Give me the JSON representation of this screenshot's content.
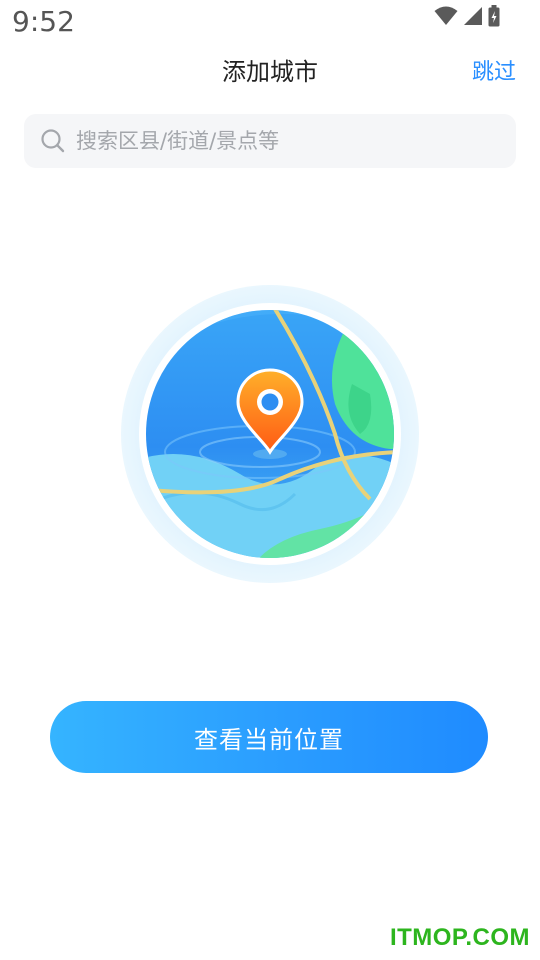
{
  "status_bar": {
    "time": "9:52"
  },
  "header": {
    "title": "添加城市",
    "skip_label": "跳过"
  },
  "search": {
    "placeholder": "搜索区县/街道/景点等",
    "value": ""
  },
  "button": {
    "label": "查看当前位置"
  },
  "watermark": "ITMOP.COM",
  "colors": {
    "accent": "#2a8fff",
    "button_start": "#35b4ff",
    "button_end": "#1f8bff",
    "pin": "#ff6a1a",
    "watermark": "#2db51e"
  },
  "icons": [
    "wifi-icon",
    "signal-icon",
    "battery-icon",
    "search-icon",
    "location-pin-icon"
  ]
}
